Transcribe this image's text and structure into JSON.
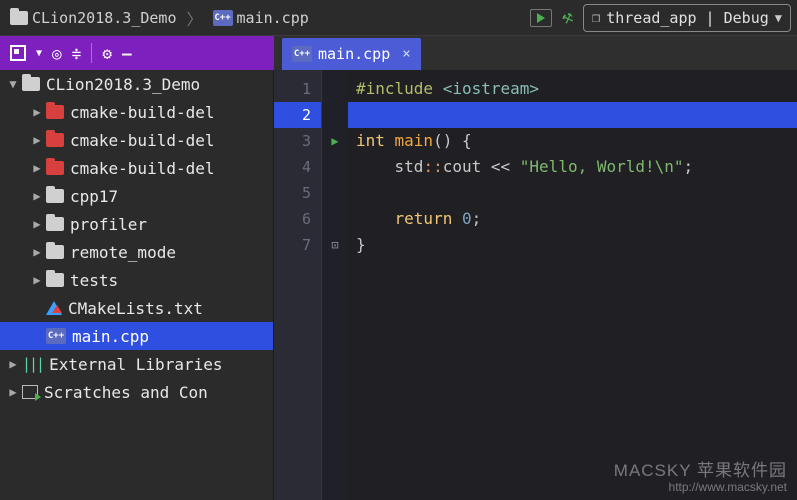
{
  "breadcrumb": {
    "project": "CLion2018.3_Demo",
    "file": "main.cpp"
  },
  "run_config": {
    "label": "thread_app | Debug"
  },
  "sidebar": {
    "root": "CLion2018.3_Demo",
    "items": [
      {
        "label": "cmake-build-del",
        "kind": "red-folder"
      },
      {
        "label": "cmake-build-del",
        "kind": "red-folder"
      },
      {
        "label": "cmake-build-del",
        "kind": "red-folder"
      },
      {
        "label": "cpp17",
        "kind": "grey-folder"
      },
      {
        "label": "profiler",
        "kind": "grey-folder"
      },
      {
        "label": "remote_mode",
        "kind": "grey-folder"
      },
      {
        "label": "tests",
        "kind": "grey-folder"
      },
      {
        "label": "CMakeLists.txt",
        "kind": "cmake"
      },
      {
        "label": "main.cpp",
        "kind": "cpp",
        "selected": true
      }
    ],
    "external": "External Libraries",
    "scratches": "Scratches and Con"
  },
  "tab": {
    "label": "main.cpp"
  },
  "code": {
    "lines": [
      {
        "n": 1,
        "tokens": [
          [
            "#include ",
            "olive"
          ],
          [
            "<iostream>",
            "angle"
          ]
        ]
      },
      {
        "n": 2,
        "tokens": [],
        "selected": true
      },
      {
        "n": 3,
        "tokens": [
          [
            "int ",
            "key"
          ],
          [
            "main",
            "func"
          ],
          [
            "() {",
            "punc"
          ]
        ],
        "run": true,
        "foldOpen": true
      },
      {
        "n": 4,
        "tokens": [
          [
            "    ",
            ""
          ],
          [
            "std",
            "std"
          ],
          [
            "::",
            "colon"
          ],
          [
            "cout ",
            "std"
          ],
          [
            "<< ",
            "punc"
          ],
          [
            "\"Hello, World!\\n\"",
            "str"
          ],
          [
            ";",
            "punc"
          ]
        ]
      },
      {
        "n": 5,
        "tokens": []
      },
      {
        "n": 6,
        "tokens": [
          [
            "    ",
            ""
          ],
          [
            "return ",
            "key"
          ],
          [
            "0",
            "num"
          ],
          [
            ";",
            "punc"
          ]
        ]
      },
      {
        "n": 7,
        "tokens": [
          [
            "}",
            "punc"
          ]
        ],
        "foldClose": true
      }
    ]
  },
  "watermark": {
    "l1": "MACSKY 苹果软件园",
    "l2": "http://www.macsky.net"
  }
}
